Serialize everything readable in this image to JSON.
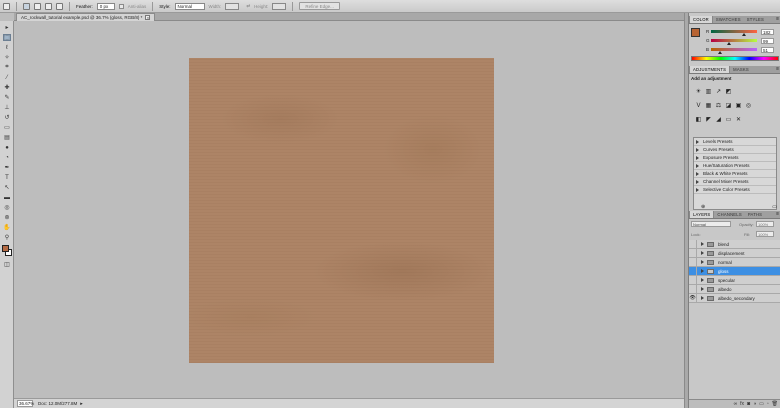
{
  "options_bar": {
    "feather_label": "Feather:",
    "feather_value": "0 px",
    "antialias_label": "Anti-alias",
    "style_label": "Style:",
    "style_value": "Normal",
    "width_label": "Width:",
    "height_label": "Height:",
    "refine_edge_label": "Refine Edge..."
  },
  "document_tab": {
    "title": "AC_rockwall_tutorial example.psd @ 36.7% (gloss, RGB/8) *",
    "close_glyph": "×"
  },
  "status_bar": {
    "zoom": "36.67%",
    "doc_size": "Doc: 12.0M/277.8M"
  },
  "color_panel": {
    "tabs": [
      "COLOR",
      "SWATCHES",
      "STYLES"
    ],
    "sliders": [
      {
        "label": "R",
        "value": "182",
        "fraction": 0.71,
        "gradient": "linear-gradient(90deg,#006442,#ff6442)"
      },
      {
        "label": "G",
        "value": "99",
        "fraction": 0.39,
        "gradient": "linear-gradient(90deg,#b60042,#b6ff42)"
      },
      {
        "label": "B",
        "value": "51",
        "fraction": 0.2,
        "gradient": "linear-gradient(90deg,#b66300,#b663ff)"
      }
    ],
    "foreground_color": "#b66333"
  },
  "adjustments_panel": {
    "tabs": [
      "ADJUSTMENTS",
      "MASKS"
    ],
    "heading": "Add an adjustment",
    "presets": [
      "Levels Presets",
      "Curves Presets",
      "Exposure Presets",
      "Hue/Saturation Presets",
      "Black & White Presets",
      "Channel Mixer Presets",
      "Selective Color Presets"
    ]
  },
  "layers_panel": {
    "tabs": [
      "LAYERS",
      "CHANNELS",
      "PATHS"
    ],
    "blend_mode": "Normal",
    "opacity_label": "Opacity:",
    "opacity_value": "100%",
    "lock_label": "Lock:",
    "fill_label": "Fill:",
    "fill_value": "100%",
    "layers": [
      {
        "name": "blend",
        "visible": false,
        "selected": false
      },
      {
        "name": "displacement",
        "visible": false,
        "selected": false
      },
      {
        "name": "normal",
        "visible": false,
        "selected": false
      },
      {
        "name": "gloss",
        "visible": false,
        "selected": true
      },
      {
        "name": "specular",
        "visible": false,
        "selected": false
      },
      {
        "name": "albedo",
        "visible": false,
        "selected": false
      },
      {
        "name": "albedo_secondary",
        "visible": true,
        "selected": false
      }
    ]
  },
  "canvas": {
    "texture_color": "#ad8466",
    "background_color": "#bdbdbd"
  }
}
